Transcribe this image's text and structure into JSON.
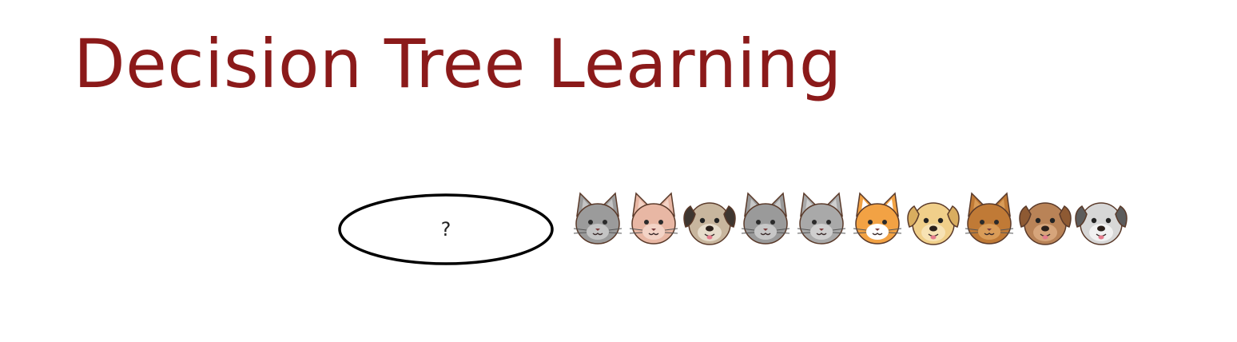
{
  "slide": {
    "title": "Decision Tree Learning"
  },
  "tree": {
    "root_label": "?"
  },
  "animals": [
    {
      "kind": "cat",
      "name": "gray-cat-smiling",
      "fur": "#9b9b9b",
      "inner": "#c4c4c4"
    },
    {
      "kind": "cat",
      "name": "pink-folded-ear-cat",
      "fur": "#e8b7a4",
      "inner": "#f3d3c6"
    },
    {
      "kind": "dog",
      "name": "pug-dog",
      "fur": "#c8b69e",
      "inner": "#e6dccb",
      "ears": "#3e3630"
    },
    {
      "kind": "cat",
      "name": "gray-tabby-cat",
      "fur": "#9a9a9a",
      "inner": "#c7c7c7"
    },
    {
      "kind": "cat",
      "name": "gray-yellow-eyed-cat",
      "fur": "#a9a9a9",
      "inner": "#cfcfcf"
    },
    {
      "kind": "cat",
      "name": "orange-white-cat",
      "fur": "#f2a244",
      "inner": "#ffffff"
    },
    {
      "kind": "dog",
      "name": "golden-puppy",
      "fur": "#f0cf8a",
      "inner": "#f7e2b4",
      "ears": "#d9ad5f"
    },
    {
      "kind": "cat",
      "name": "brown-cat",
      "fur": "#c07a36",
      "inner": "#d99c58"
    },
    {
      "kind": "dog",
      "name": "brown-dog",
      "fur": "#b98357",
      "inner": "#d6a57b",
      "ears": "#8e5a33"
    },
    {
      "kind": "dog",
      "name": "gray-white-dog",
      "fur": "#d7d7d7",
      "inner": "#f1f1f1",
      "ears": "#5c5c5c"
    }
  ],
  "colors": {
    "title": "#8b1a1a",
    "node_stroke": "#000000",
    "outline": "#5a3a2a"
  }
}
